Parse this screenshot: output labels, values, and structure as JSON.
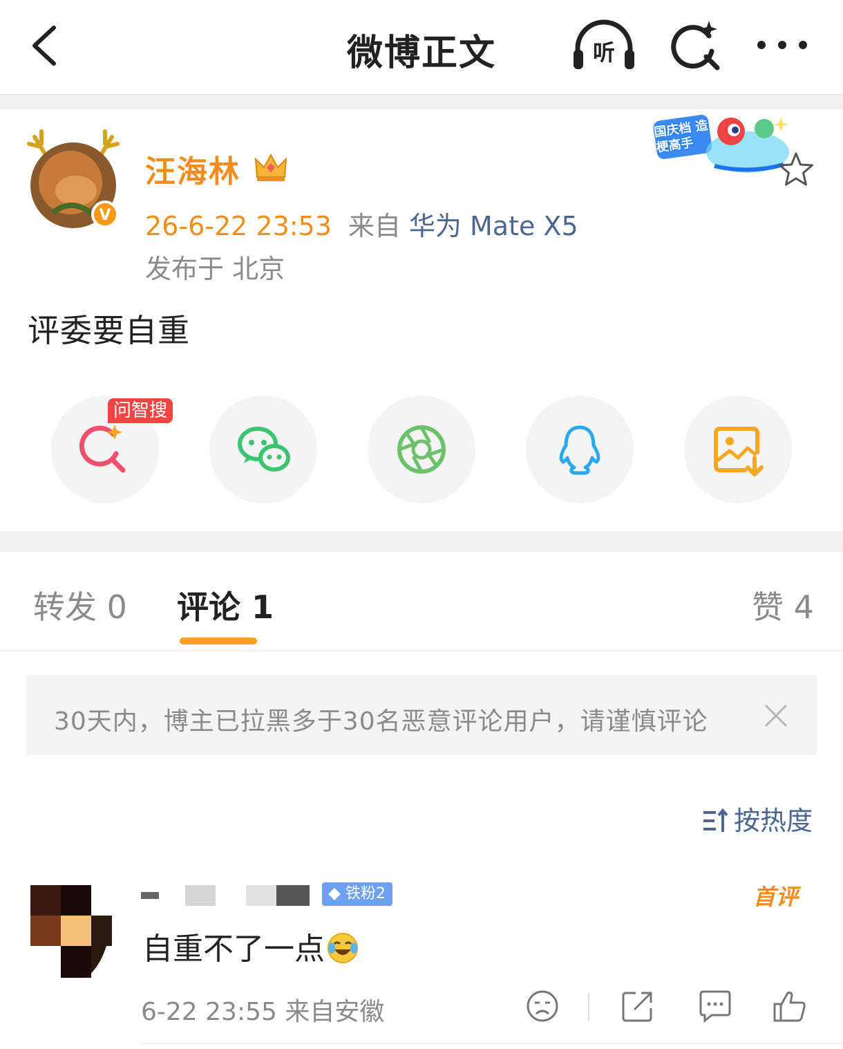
{
  "header": {
    "title": "微博正文",
    "listen_label": "听",
    "icons": [
      "back-arrow-icon",
      "listen-headphones-icon",
      "ai-search-icon",
      "more-dots-icon"
    ]
  },
  "post": {
    "author": "汪海林",
    "time": "26-6-22 23:53",
    "from_label": "来自",
    "device": "华为 Mate X5",
    "location": "发布于 北京",
    "content": "评委要自重",
    "sticker_text": "国庆档 造梗高手"
  },
  "share": {
    "badge": "问智搜",
    "items": [
      "ai-search-share-icon",
      "wechat-icon",
      "moments-icon",
      "qq-icon",
      "save-image-icon"
    ]
  },
  "tabs": {
    "repost": "转发 0",
    "comments": "评论 1",
    "likes": "赞 4",
    "active": "comments"
  },
  "notice": {
    "text": "30天内，博主已拉黑多于30名恶意评论用户，请谨慎评论"
  },
  "sort": {
    "label": "按热度"
  },
  "comment": {
    "fan_badge": "铁粉2",
    "first_badge": "首评",
    "text": "自重不了一点",
    "meta": "6-22 23:55 来自安徽"
  },
  "colors": {
    "accent_orange": "#f28d1c",
    "link_blue": "#4b6791",
    "tab_underline": "#f7a21b",
    "badge_red": "#f04545"
  }
}
